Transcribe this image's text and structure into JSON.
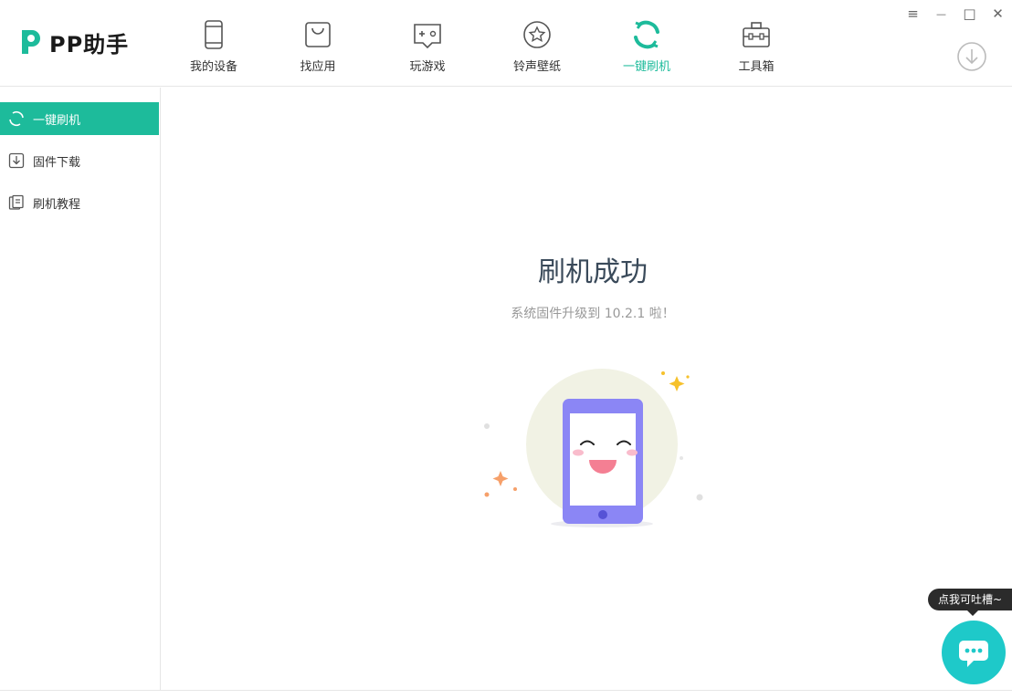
{
  "app": {
    "logo_text": "PP助手",
    "brand_color": "#1dbb9b"
  },
  "nav": {
    "items": [
      {
        "label": "我的设备",
        "icon": "phone-icon",
        "active": false
      },
      {
        "label": "找应用",
        "icon": "shopping-bag-icon",
        "active": false
      },
      {
        "label": "玩游戏",
        "icon": "gamepad-icon",
        "active": false
      },
      {
        "label": "铃声壁纸",
        "icon": "star-icon",
        "active": false
      },
      {
        "label": "一键刷机",
        "icon": "refresh-icon",
        "active": true
      },
      {
        "label": "工具箱",
        "icon": "toolbox-icon",
        "active": false
      }
    ]
  },
  "window": {
    "menu_glyph": "≡",
    "minimize_glyph": "—",
    "maximize_glyph": "□",
    "close_glyph": "✕"
  },
  "sidebar": {
    "items": [
      {
        "label": "一键刷机",
        "icon": "refresh-icon",
        "active": true
      },
      {
        "label": "固件下载",
        "icon": "download-icon",
        "active": false
      },
      {
        "label": "刷机教程",
        "icon": "tutorial-icon",
        "active": false
      }
    ]
  },
  "main": {
    "title": "刷机成功",
    "subtitle": "系统固件升级到 10.2.1 啦！"
  },
  "feedback": {
    "tooltip": "点我可吐槽~",
    "button_color": "#1ec9c9"
  }
}
